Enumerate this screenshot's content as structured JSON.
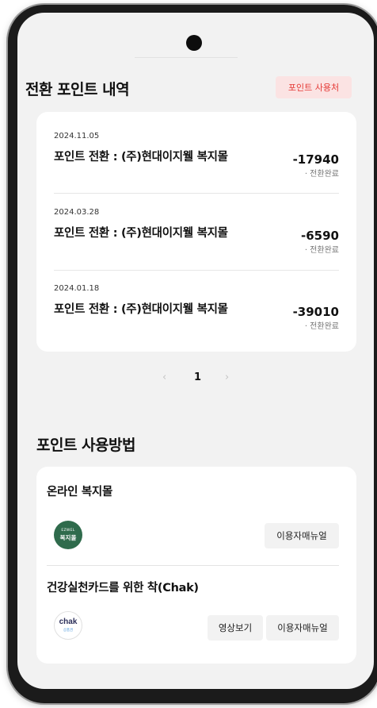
{
  "history": {
    "title": "전환 포인트 내역",
    "shop_button": "포인트 사용처",
    "items": [
      {
        "date": "2024.11.05",
        "desc": "포인트 전환 : (주)현대이지웰 복지몰",
        "amount": "-17940",
        "status": "· 전환완료"
      },
      {
        "date": "2024.03.28",
        "desc": "포인트 전환 : (주)현대이지웰 복지몰",
        "amount": "-6590",
        "status": "· 전환완료"
      },
      {
        "date": "2024.01.18",
        "desc": "포인트 전환 : (주)현대이지웰 복지몰",
        "amount": "-39010",
        "status": "· 전환완료"
      }
    ]
  },
  "pagination": {
    "prev": "‹",
    "current": "1",
    "next": "›"
  },
  "usage": {
    "title": "포인트 사용방법",
    "methods": [
      {
        "title": "온라인 복지몰",
        "logo_small": "EZWEL",
        "logo_big": "복지몰",
        "buttons": [
          "이용자매뉴얼"
        ]
      },
      {
        "title": "건강실천카드를 위한 착(Chak)",
        "logo_word": "chak",
        "logo_sub": "상품권",
        "buttons": [
          "영상보기",
          "이용자매뉴얼"
        ]
      }
    ]
  }
}
